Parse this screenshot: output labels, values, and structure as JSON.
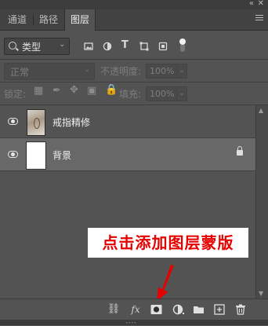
{
  "window": {
    "collapse_glyph": "«",
    "close_glyph": "✕"
  },
  "tabs": [
    {
      "label": "通道"
    },
    {
      "label": "路径"
    },
    {
      "label": "图层",
      "active": true
    }
  ],
  "filter": {
    "kind_label": "类型",
    "icons": [
      "pixel-filter-icon",
      "adjustment-filter-icon",
      "type-filter-icon",
      "shape-filter-icon",
      "smart-object-filter-icon"
    ],
    "type_glyph": "T"
  },
  "blend": {
    "mode": "正常",
    "opacity_label": "不透明度:",
    "opacity_value": "100%"
  },
  "lock": {
    "label": "锁定:",
    "fill_label": "填充:",
    "fill_value": "100%"
  },
  "layers": [
    {
      "name": "戒指精修",
      "visible": true,
      "thumbnail": "photo",
      "selected": false,
      "locked": false
    },
    {
      "name": "背景",
      "visible": true,
      "thumbnail": "white",
      "selected": true,
      "locked": true
    }
  ],
  "annotation": {
    "text": "点击添加图层蒙版",
    "color": "#e60000"
  },
  "bottom_toolbar": [
    {
      "icon": "link-layers-icon",
      "glyph": "⛓"
    },
    {
      "icon": "fx-icon",
      "glyph": "fx"
    },
    {
      "icon": "add-mask-icon",
      "glyph": ""
    },
    {
      "icon": "adjustment-layer-icon",
      "glyph": ""
    },
    {
      "icon": "folder-icon",
      "glyph": ""
    },
    {
      "icon": "new-layer-icon",
      "glyph": "+"
    },
    {
      "icon": "trash-icon",
      "glyph": ""
    }
  ]
}
